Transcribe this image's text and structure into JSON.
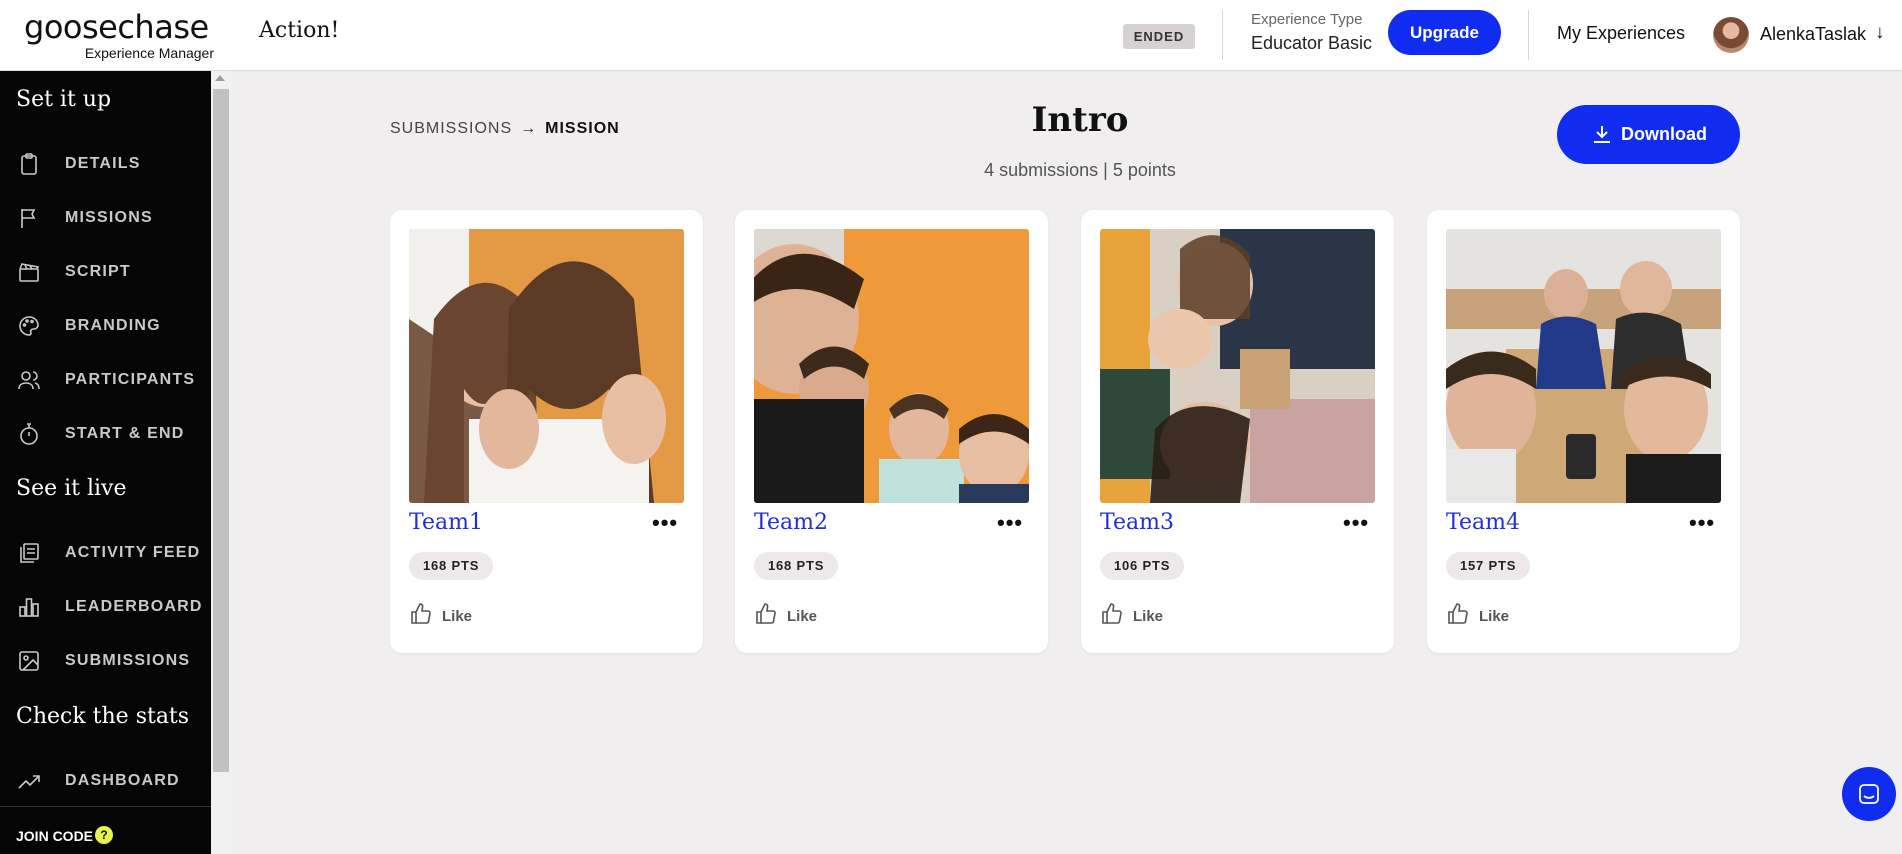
{
  "header": {
    "logo_main": "goosechase",
    "logo_sub": "Experience Manager",
    "experience_name": "Action!",
    "status_badge": "ENDED",
    "experience_type_label": "Experience Type",
    "experience_type_value": "Educator Basic",
    "upgrade_label": "Upgrade",
    "my_experiences_label": "My Experiences",
    "username": "AlenkaTaslak",
    "user_menu_arrow": "↓"
  },
  "sidebar": {
    "section_setup": "Set it up",
    "section_live": "See it live",
    "section_stats": "Check the stats",
    "items": [
      {
        "label": "DETAILS",
        "icon": "clipboard-icon"
      },
      {
        "label": "MISSIONS",
        "icon": "flag-icon"
      },
      {
        "label": "SCRIPT",
        "icon": "clapperboard-icon"
      },
      {
        "label": "BRANDING",
        "icon": "palette-icon"
      },
      {
        "label": "PARTICIPANTS",
        "icon": "people-icon"
      },
      {
        "label": "START & END",
        "icon": "stopwatch-icon"
      },
      {
        "label": "ACTIVITY FEED",
        "icon": "stacked-pages-icon"
      },
      {
        "label": "LEADERBOARD",
        "icon": "bar-chart-icon"
      },
      {
        "label": "SUBMISSIONS",
        "icon": "image-icon"
      },
      {
        "label": "DASHBOARD",
        "icon": "trend-line-icon"
      }
    ],
    "join_code_label": "JOIN CODE",
    "join_code_help": "?"
  },
  "breadcrumb": {
    "parent": "SUBMISSIONS",
    "arrow": "→",
    "current": "MISSION"
  },
  "mission": {
    "title": "Intro",
    "meta": "4 submissions | 5 points"
  },
  "download_label": "Download",
  "submissions": [
    {
      "team": "Team1",
      "points": "168 PTS",
      "like_label": "Like",
      "more": "•••"
    },
    {
      "team": "Team2",
      "points": "168 PTS",
      "like_label": "Like",
      "more": "•••"
    },
    {
      "team": "Team3",
      "points": "106 PTS",
      "like_label": "Like",
      "more": "•••"
    },
    {
      "team": "Team4",
      "points": "157 PTS",
      "like_label": "Like",
      "more": "•••"
    }
  ],
  "colors": {
    "accent": "#0f2cf0",
    "team_link": "#1f2fd9",
    "sidebar_bg": "#050505",
    "page_bg": "#f1eeef",
    "join_help": "#e6f34a"
  }
}
